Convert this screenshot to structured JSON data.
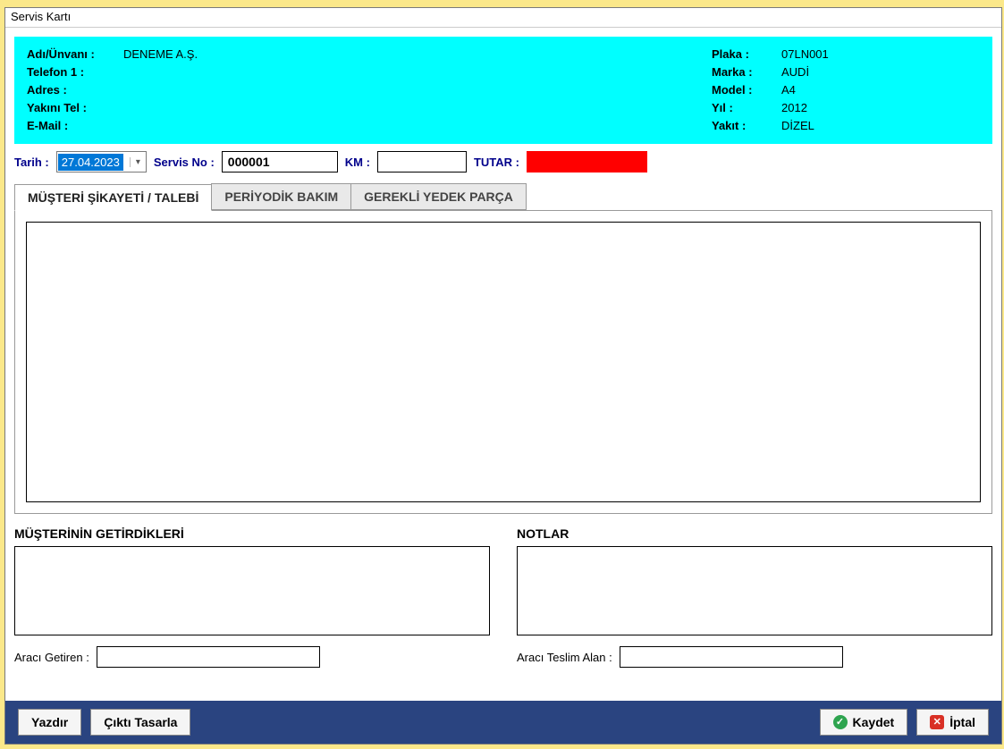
{
  "window": {
    "title": "Servis Kartı"
  },
  "customer": {
    "labels": {
      "name": "Adı/Ünvanı :",
      "phone1": "Telefon 1 :",
      "address": "Adres :",
      "relativePhone": "Yakını Tel :",
      "email": "E-Mail :"
    },
    "values": {
      "name": "DENEME A.Ş.",
      "phone1": "",
      "address": "",
      "relativePhone": "",
      "email": ""
    }
  },
  "vehicle": {
    "labels": {
      "plate": "Plaka :",
      "brand": "Marka :",
      "model": "Model :",
      "year": "Yıl :",
      "fuel": "Yakıt :"
    },
    "values": {
      "plate": "07LN001",
      "brand": "AUDİ",
      "model": "A4",
      "year": "2012",
      "fuel": "DİZEL"
    }
  },
  "service": {
    "labels": {
      "date": "Tarih :",
      "serviceNo": "Servis No :",
      "km": "KM :",
      "total": "TUTAR :"
    },
    "values": {
      "date": "27.04.2023",
      "serviceNo": "000001",
      "km": "",
      "total": ""
    }
  },
  "tabs": {
    "complaint": "MÜŞTERİ  ŞİKAYETİ / TALEBİ",
    "periodic": "PERİYODİK BAKIM",
    "parts": "GEREKLİ YEDEK PARÇA"
  },
  "lower": {
    "brought": {
      "title": "MÜŞTERİNİN GETİRDİKLERİ",
      "value": ""
    },
    "notes": {
      "title": "NOTLAR",
      "value": ""
    },
    "bringer": {
      "label": "Aracı Getiren :",
      "value": ""
    },
    "receiver": {
      "label": "Aracı Teslim Alan :",
      "value": ""
    }
  },
  "footer": {
    "print": "Yazdır",
    "design": "Çıktı Tasarla",
    "save": "Kaydet",
    "cancel": "İptal"
  }
}
